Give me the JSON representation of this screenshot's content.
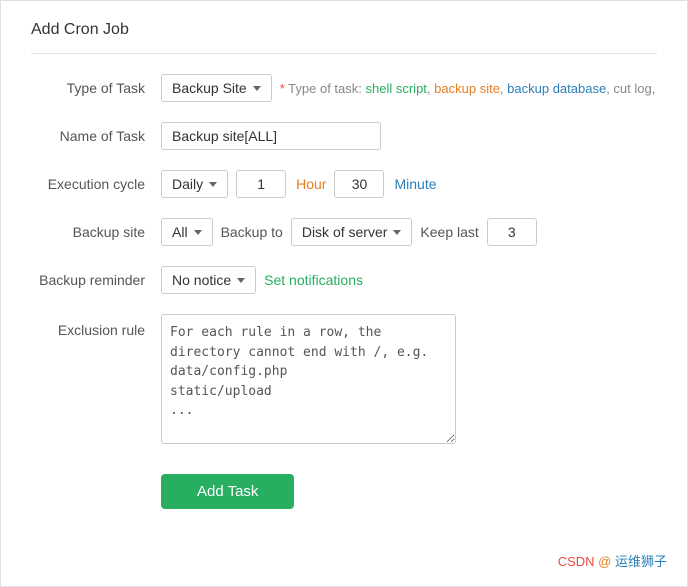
{
  "title": "Add Cron Job",
  "form": {
    "type_of_task": {
      "label": "Type of Task",
      "value": "Backup Site",
      "hint_prefix": "* Type of task:",
      "hint_items": [
        "shell script",
        "backup site",
        "backup database",
        "cut log,"
      ]
    },
    "name_of_task": {
      "label": "Name of Task",
      "value": "Backup site[ALL]",
      "placeholder": "Backup site[ALL]"
    },
    "execution_cycle": {
      "label": "Execution cycle",
      "cycle_value": "Daily",
      "hour_value": "1",
      "hour_unit": "Hour",
      "minute_value": "30",
      "minute_unit": "Minute"
    },
    "backup_site": {
      "label": "Backup site",
      "site_value": "All",
      "backup_to_label": "Backup to",
      "destination_value": "Disk of server",
      "keep_last_label": "Keep last",
      "keep_last_value": "3"
    },
    "backup_reminder": {
      "label": "Backup reminder",
      "value": "No notice",
      "set_notifications": "Set notifications"
    },
    "exclusion_rule": {
      "label": "Exclusion rule",
      "placeholder_lines": "For each rule in a row, the directory cannot end with /, e.g.\ndata/config.php\nstatic/upload\n..."
    }
  },
  "buttons": {
    "add_task": "Add Task"
  },
  "watermark": "CSDN @运维狮子"
}
